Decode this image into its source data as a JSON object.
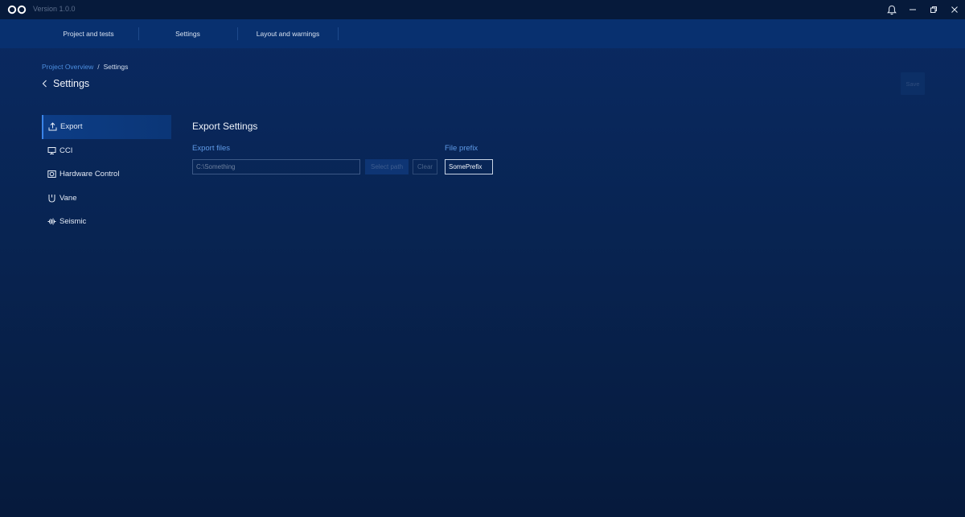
{
  "titlebar": {
    "version": "Version 1.0.0",
    "icons": [
      "infinity-logo-icon",
      "bell-icon",
      "minimize-icon",
      "restore-icon",
      "close-icon"
    ]
  },
  "topnav": {
    "items": [
      {
        "label": "Project and tests"
      },
      {
        "label": "Settings"
      },
      {
        "label": "Layout and warnings"
      }
    ]
  },
  "breadcrumb": {
    "parent": "Project Overview",
    "separator": "/",
    "current": "Settings"
  },
  "page": {
    "title": "Settings",
    "save_label": "Save"
  },
  "sidebar": {
    "items": [
      {
        "label": "Export",
        "icon": "upload-icon",
        "active": true
      },
      {
        "label": "CCI",
        "icon": "monitor-icon"
      },
      {
        "label": "Hardware Control",
        "icon": "camera-icon"
      },
      {
        "label": "Vane",
        "icon": "shield-icon"
      },
      {
        "label": "Seismic",
        "icon": "waveform-icon"
      }
    ]
  },
  "export": {
    "section_title": "Export Settings",
    "export_files_label": "Export files",
    "path_value": "C:\\Something",
    "select_path_label": "Select path",
    "clear_label": "Clear",
    "file_prefix_label": "File prefix",
    "file_prefix_value": "SomePrefix"
  },
  "colors": {
    "accent": "#3a84e8",
    "link": "#4d8fe0",
    "background_top": "#0a2a63",
    "background_bottom": "#061a3c"
  }
}
